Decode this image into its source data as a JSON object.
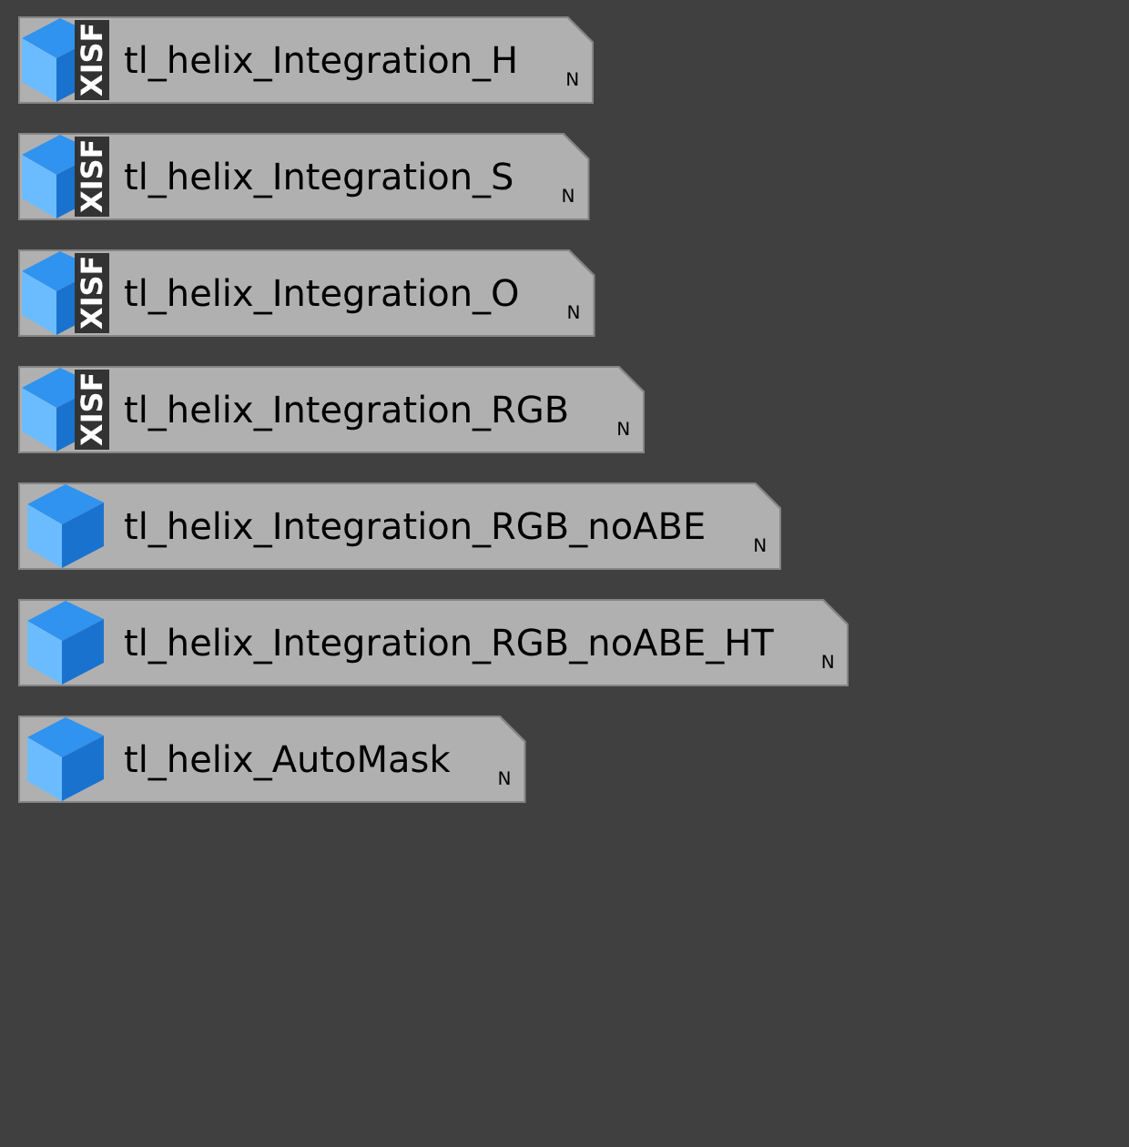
{
  "icons": [
    {
      "name": "tl_helix_Integration_H",
      "badge": "XISF",
      "marker": "N",
      "selected": false
    },
    {
      "name": "tl_helix_Integration_S",
      "badge": "XISF",
      "marker": "N",
      "selected": false
    },
    {
      "name": "tl_helix_Integration_O",
      "badge": "XISF",
      "marker": "N",
      "selected": false
    },
    {
      "name": "tl_helix_Integration_RGB",
      "badge": "XISF",
      "marker": "N",
      "selected": false
    },
    {
      "name": "tl_helix_Integration_RGB_noABE",
      "marker": "N",
      "selected": false
    },
    {
      "name": "tl_helix_Integration_RGB_noABE_HT",
      "marker": "N",
      "selected": false
    },
    {
      "name": "tl_helix_AutoMask",
      "marker": "N",
      "selected": false
    }
  ]
}
